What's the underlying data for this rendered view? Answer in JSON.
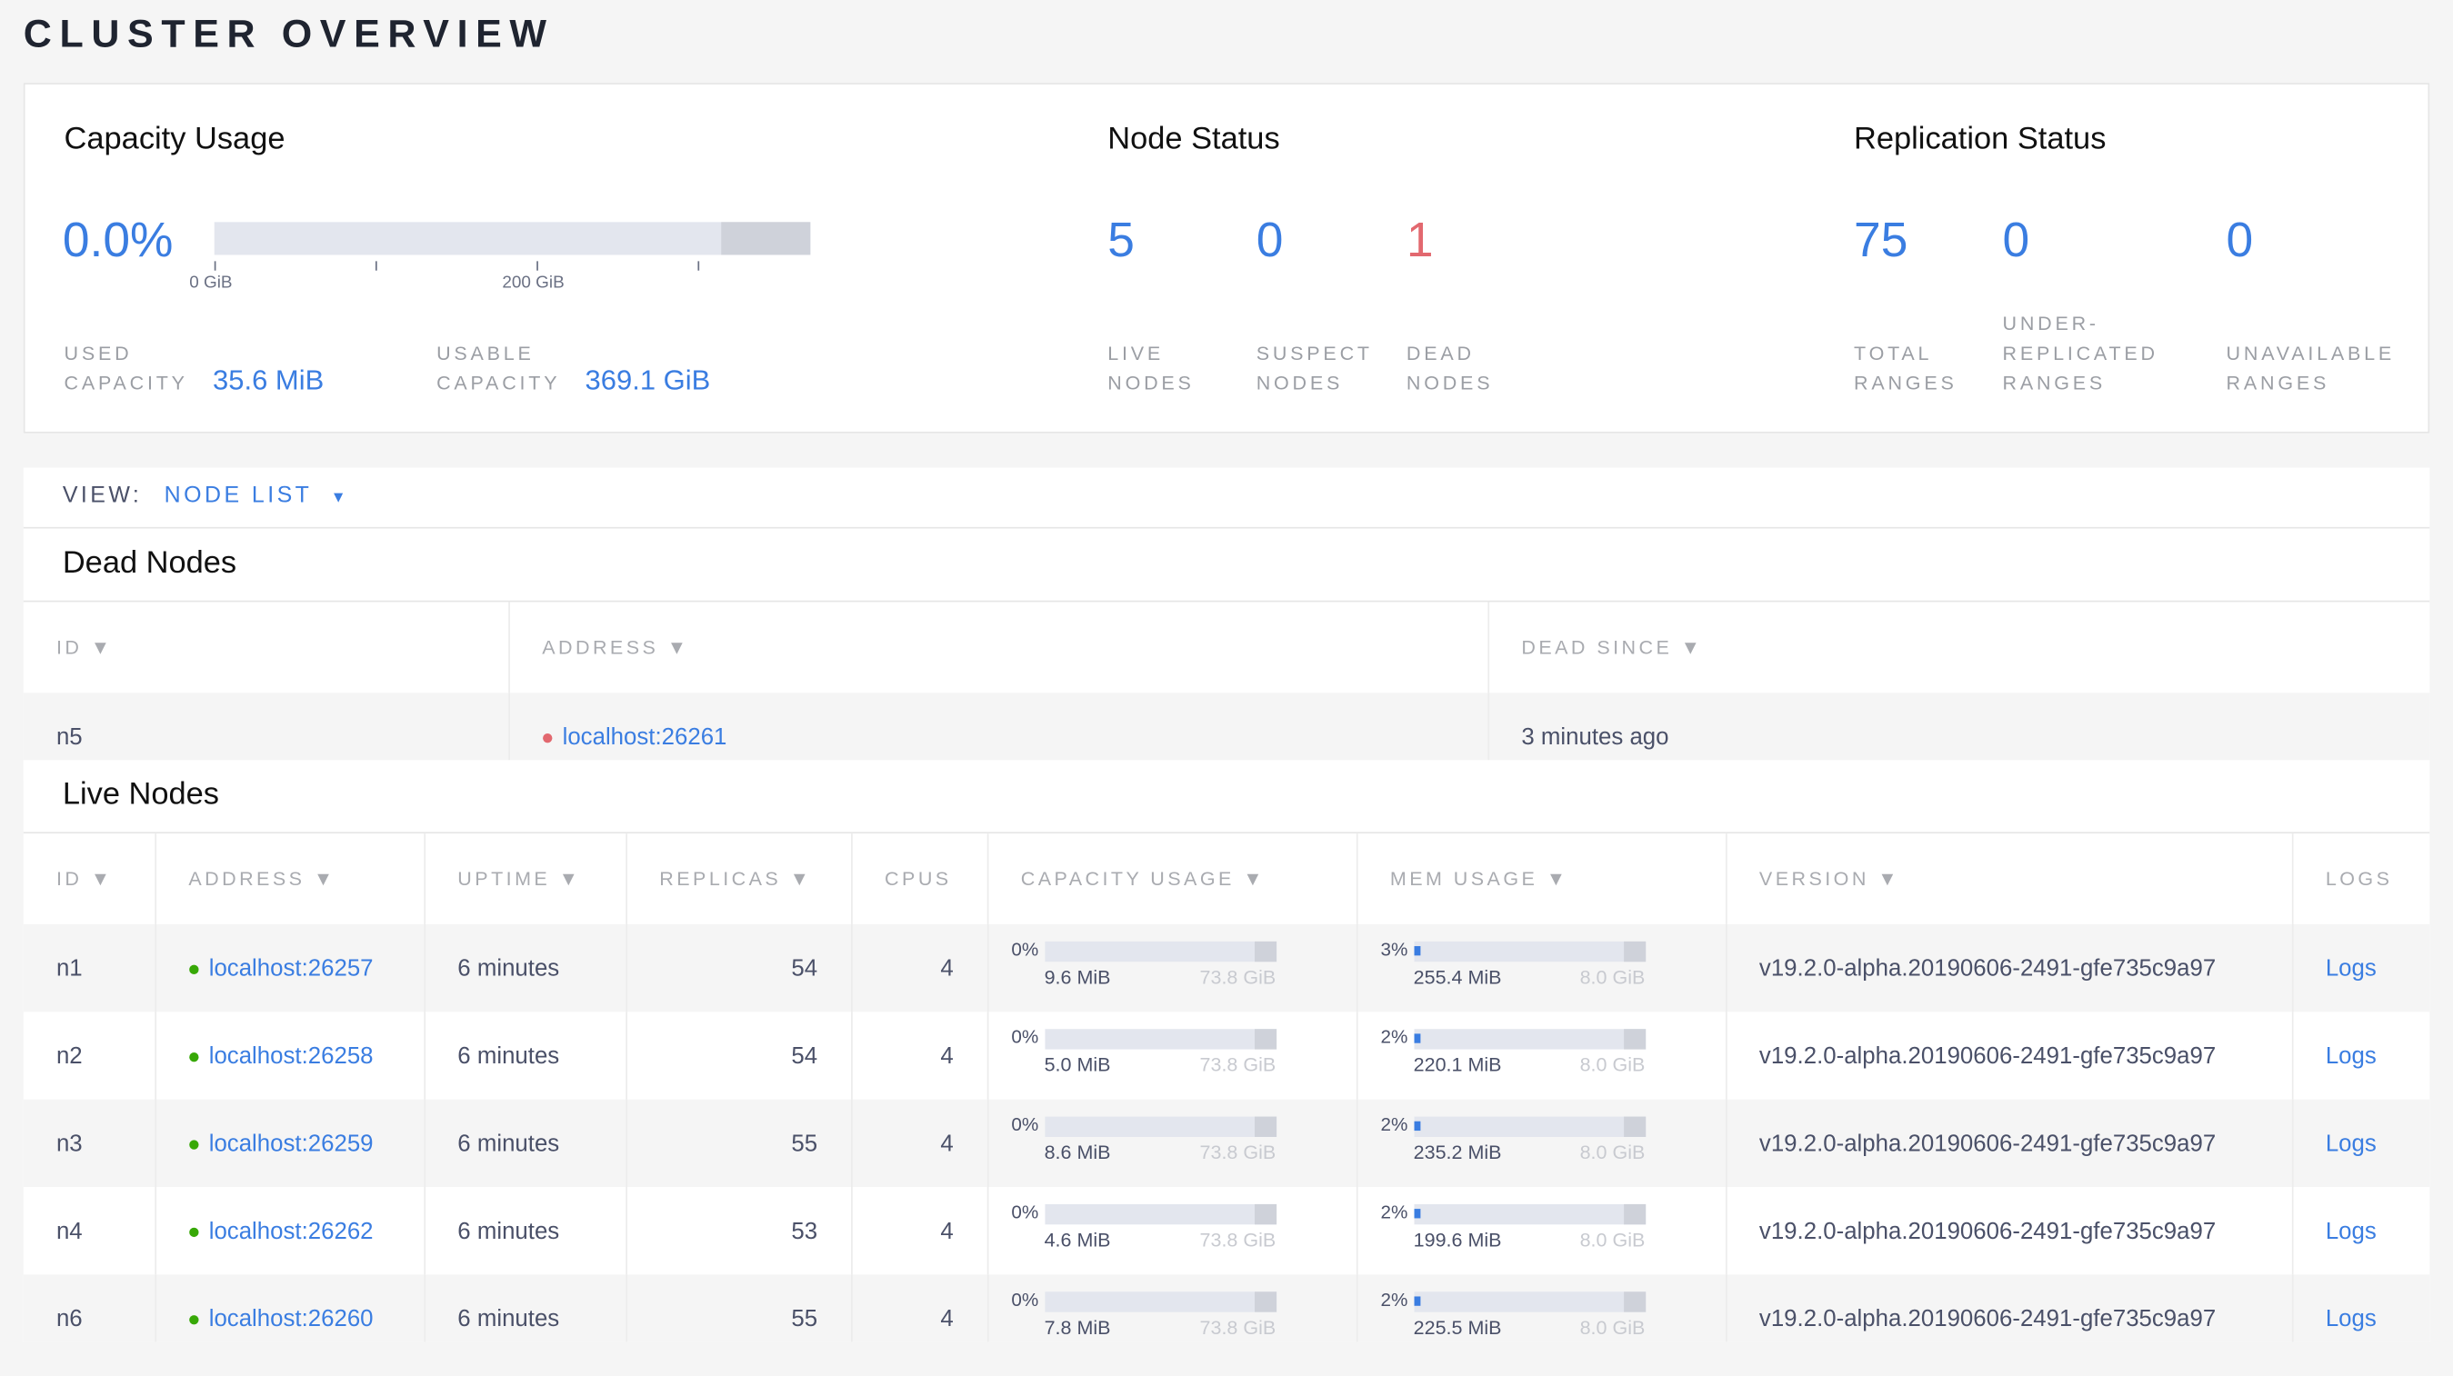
{
  "page_title": "CLUSTER OVERVIEW",
  "capacity": {
    "title": "Capacity Usage",
    "percent": "0.0%",
    "used_fraction": 0.0,
    "usable_fraction_of_axis": 0.85,
    "ticks": [
      "0 GiB",
      "200 GiB"
    ],
    "used_label_1": "USED",
    "used_label_2": "CAPACITY",
    "used_value": "35.6 MiB",
    "usable_label_1": "USABLE",
    "usable_label_2": "CAPACITY",
    "usable_value": "369.1 GiB"
  },
  "node_status": {
    "title": "Node Status",
    "items": [
      {
        "value": "5",
        "label_1": "LIVE",
        "label_2": "NODES",
        "color": "#3a7de1"
      },
      {
        "value": "0",
        "label_1": "SUSPECT",
        "label_2": "NODES",
        "color": "#3a7de1"
      },
      {
        "value": "1",
        "label_1": "DEAD",
        "label_2": "NODES",
        "color": "#e2686f"
      }
    ]
  },
  "replication": {
    "title": "Replication Status",
    "items": [
      {
        "value": "75",
        "label_0": "",
        "label_1": "TOTAL",
        "label_2": "RANGES"
      },
      {
        "value": "0",
        "label_0": "UNDER-",
        "label_1": "REPLICATED",
        "label_2": "RANGES"
      },
      {
        "value": "0",
        "label_0": "",
        "label_1": "UNAVAILABLE",
        "label_2": "RANGES"
      }
    ]
  },
  "view": {
    "label": "VIEW:",
    "value": "NODE LIST"
  },
  "dead_nodes": {
    "title": "Dead Nodes",
    "columns": [
      "ID ▼",
      "ADDRESS ▼",
      "DEAD SINCE ▼"
    ],
    "rows": [
      {
        "id": "n5",
        "address": "localhost:26261",
        "dead_since": "3 minutes ago"
      }
    ]
  },
  "live_nodes": {
    "title": "Live Nodes",
    "columns": [
      "ID ▼",
      "ADDRESS ▼",
      "UPTIME ▼",
      "REPLICAS ▼",
      "CPUS",
      "CAPACITY USAGE ▼",
      "MEM USAGE ▼",
      "VERSION ▼",
      "LOGS"
    ],
    "rows": [
      {
        "id": "n1",
        "address": "localhost:26257",
        "uptime": "6 minutes",
        "replicas": "54",
        "cpus": "4",
        "cap_pct": "0%",
        "cap_used": "9.6 MiB",
        "cap_total": "73.8 GiB",
        "mem_pct": "3%",
        "mem_used": "255.4 MiB",
        "mem_total": "8.0 GiB",
        "version": "v19.2.0-alpha.20190606-2491-gfe735c9a97",
        "logs": "Logs"
      },
      {
        "id": "n2",
        "address": "localhost:26258",
        "uptime": "6 minutes",
        "replicas": "54",
        "cpus": "4",
        "cap_pct": "0%",
        "cap_used": "5.0 MiB",
        "cap_total": "73.8 GiB",
        "mem_pct": "2%",
        "mem_used": "220.1 MiB",
        "mem_total": "8.0 GiB",
        "version": "v19.2.0-alpha.20190606-2491-gfe735c9a97",
        "logs": "Logs"
      },
      {
        "id": "n3",
        "address": "localhost:26259",
        "uptime": "6 minutes",
        "replicas": "55",
        "cpus": "4",
        "cap_pct": "0%",
        "cap_used": "8.6 MiB",
        "cap_total": "73.8 GiB",
        "mem_pct": "2%",
        "mem_used": "235.2 MiB",
        "mem_total": "8.0 GiB",
        "version": "v19.2.0-alpha.20190606-2491-gfe735c9a97",
        "logs": "Logs"
      },
      {
        "id": "n4",
        "address": "localhost:26262",
        "uptime": "6 minutes",
        "replicas": "53",
        "cpus": "4",
        "cap_pct": "0%",
        "cap_used": "4.6 MiB",
        "cap_total": "73.8 GiB",
        "mem_pct": "2%",
        "mem_used": "199.6 MiB",
        "mem_total": "8.0 GiB",
        "version": "v19.2.0-alpha.20190606-2491-gfe735c9a97",
        "logs": "Logs"
      },
      {
        "id": "n6",
        "address": "localhost:26260",
        "uptime": "6 minutes",
        "replicas": "55",
        "cpus": "4",
        "cap_pct": "0%",
        "cap_used": "7.8 MiB",
        "cap_total": "73.8 GiB",
        "mem_pct": "2%",
        "mem_used": "225.5 MiB",
        "mem_total": "8.0 GiB",
        "version": "v19.2.0-alpha.20190606-2491-gfe735c9a97",
        "logs": "Logs"
      }
    ]
  },
  "colors": {
    "accent": "#3a7de1",
    "dead": "#e2686f",
    "live": "#37a806"
  }
}
